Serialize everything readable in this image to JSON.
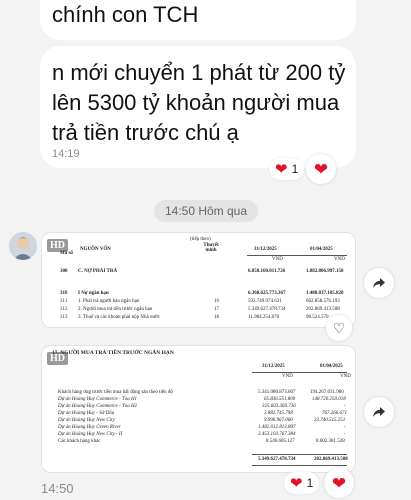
{
  "messages": {
    "msg1_text": "chính con TCH",
    "msg2_text": "n mới chuyển 1 phát từ 200 tỷ lên 5300 tỷ khoản người mua trả tiền trước chú ạ",
    "msg2_time": "14:19",
    "msg2_reaction_count": "1",
    "date_divider": "14:50 Hôm qua",
    "last_time": "14:50",
    "img2_reaction_count": "1"
  },
  "image1": {
    "hd": "HD",
    "header_note": "(tiếp theo)",
    "col_source": "NGUỒN VỐN",
    "col_code": "Mã số",
    "col_note": "Thuyết minh",
    "col_date1": "31/12/2025",
    "col_date2": "01/04/2025",
    "unit1": "VND",
    "unit2": "VND",
    "rows": [
      {
        "code": "300",
        "name": "C. NỢ PHẢI TRẢ",
        "note": "",
        "v1": "6.850.160.011.726",
        "v2": "1.882.806.997.158"
      },
      {
        "code": "310",
        "name": "I Nợ ngắn hạn",
        "note": "",
        "v1": "6.368.625.773.367",
        "v2": "1.488.037.105.820"
      },
      {
        "code": "311",
        "name": "1. Phải trả người bán ngắn hạn",
        "note": "16",
        "v1": "592.749.974.631",
        "v2": "662.858.576.193"
      },
      {
        "code": "312",
        "name": "2. Người mua trả tiền trước ngắn hạn",
        "note": "17",
        "v1": "5.349.627.478.734",
        "v2": "202.869.413.508"
      },
      {
        "code": "313",
        "name": "3. Thuế và các khoản phải nộp Nhà nước",
        "note": "18",
        "v1": "11.984.254.670",
        "v2": "98.524.570"
      }
    ]
  },
  "image2": {
    "hd": "HD",
    "title": "17. NGƯỜI MUA TRẢ TIỀN TRƯỚC NGẮN HẠN",
    "col_date1": "31/12/2025",
    "col_date2": "01/04/2025",
    "unit1": "VND",
    "unit2": "VND",
    "rows": [
      {
        "name": "Khách hàng ứng trước tiền mua bất động sản theo tiến độ",
        "v1": "5.341.080.873.607",
        "v2": "194.267.031.980"
      },
      {
        "name": "Dự án Hoang Huy Commerce - Tòa H1",
        "v1": "65.836.551.800",
        "v2": "148.720.250.018"
      },
      {
        "name": "Dự án Hoang Huy Commerce - Tòa H2",
        "v1": "325.603.369.736",
        "v2": "-"
      },
      {
        "name": "Dự án Hoàng Huy - Sở Dầu",
        "v1": "3.882.745.798",
        "v2": "767.266.671"
      },
      {
        "name": "Dự án Hoàng Huy New City",
        "v1": "9.990.967.060",
        "v2": "33.740.515.251"
      },
      {
        "name": "Dự án Hoang Huy Green River",
        "v1": "1.482.612.813.807",
        "v2": "-"
      },
      {
        "name": "Dự án Hoàng Huy New City - II",
        "v1": "3.453.103.767.384",
        "v2": "-"
      },
      {
        "name": "Các khách hàng khác",
        "v1": "8.546.605.127",
        "v2": "8.602.381.528"
      }
    ],
    "total_v1": "5.349.627.478.734",
    "total_v2": "202.869.413.508"
  },
  "icons": {
    "share": "share-arrow-icon",
    "heart": "heart-icon",
    "reaction_add": "heart-outline-icon"
  },
  "colors": {
    "background": "#f3f3f3",
    "bubble": "#ffffff",
    "heart": "#e2122b"
  }
}
